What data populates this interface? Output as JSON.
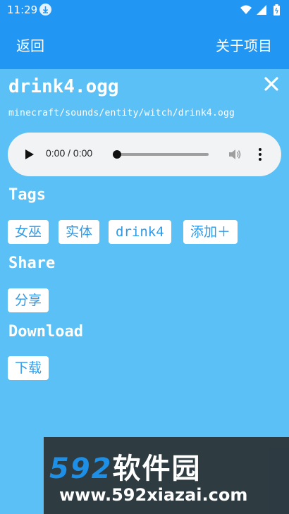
{
  "status": {
    "time": "11:29"
  },
  "toolbar": {
    "back_label": "返回",
    "about_label": "关于项目"
  },
  "file": {
    "name": "drink4.ogg",
    "path": "minecraft/sounds/entity/witch/drink4.ogg"
  },
  "player": {
    "time": "0:00 / 0:00",
    "progress": 0
  },
  "sections": {
    "tags": {
      "title": "Tags",
      "items": [
        "女巫",
        "实体",
        "drink4"
      ],
      "add_label": "添加＋"
    },
    "share": {
      "title": "Share",
      "button_label": "分享"
    },
    "download": {
      "title": "Download",
      "button_label": "下载"
    }
  },
  "watermark": {
    "brand_num": "592",
    "brand_text": "软件园",
    "url": "www.592xiazai.com"
  },
  "colors": {
    "accent": "#2196f3",
    "background": "#5bc0f5",
    "chip_text": "#2d9be9"
  },
  "icons": [
    "download-status-icon",
    "wifi-icon",
    "signal-icon",
    "battery-icon",
    "close-icon",
    "play-icon",
    "volume-icon",
    "more-vert-icon"
  ]
}
